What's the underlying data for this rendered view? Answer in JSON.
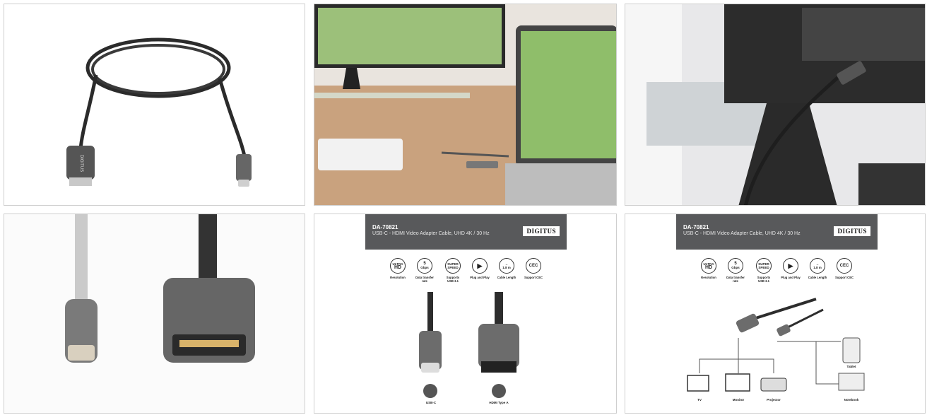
{
  "tiles": [
    {
      "alt": "cable-photo"
    },
    {
      "alt": "laptop-setup-photo"
    },
    {
      "alt": "monitor-connection-photo"
    },
    {
      "alt": "connector-closeup-photo"
    }
  ],
  "infographic": {
    "code": "DA-70821",
    "description": "USB-C - HDMI Video Adapter Cable, UHD 4K / 30 Hz",
    "brand": "DIGITUS",
    "features": [
      {
        "icon": "ULTRA HD",
        "sub": "4K / 30Hz",
        "label": "Resolution"
      },
      {
        "icon": "5 Gbps",
        "sub": "",
        "label": "Data transfer rate"
      },
      {
        "icon": "SUPER SPEED USB 3.1",
        "sub": "",
        "label": "Supports USB 3.1"
      },
      {
        "icon": "play-icon",
        "sub": "",
        "label": "Plug and Play"
      },
      {
        "icon": "1.8 m Length",
        "sub": "",
        "label": "Cable Length"
      },
      {
        "icon": "CEC",
        "sub": "",
        "label": "Support CEC"
      }
    ],
    "connector_labels": {
      "usbc": "USB-C",
      "hdmi": "HDMI Type A"
    },
    "devices": {
      "tv": "TV",
      "monitor": "Monitor",
      "projector": "Projector",
      "tablet": "Tablet",
      "notebook": "Notebook"
    }
  },
  "colors": {
    "banner": "#58595b",
    "cable": "#2f2f2f",
    "connector": "#6c6c6c"
  }
}
